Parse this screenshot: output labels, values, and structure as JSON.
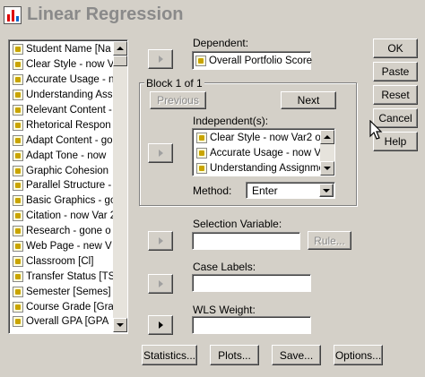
{
  "window": {
    "title": "Linear Regression"
  },
  "variables": {
    "items": [
      "Student Name [Na",
      "Clear Style - now V",
      "Accurate Usage - n",
      "Understanding Assig",
      "Relevant Content -",
      "Rhetorical Respon",
      "Adapt Content - go",
      "Adapt Tone - now",
      "Graphic Cohesion",
      "Parallel Structure -",
      "Basic Graphics - go",
      "Citation - now Var 2",
      "Research - gone o",
      "Web Page - new V",
      "Classroom [Cl]",
      "Transfer Status [TS",
      "Semester [Semes]",
      "Course Grade [Gra",
      "Overall GPA [GPA"
    ]
  },
  "dependent": {
    "label": "Dependent:",
    "value": "Overall Portfolio Score"
  },
  "block": {
    "label": "Block 1 of 1",
    "previous_label": "Previous",
    "next_label": "Next"
  },
  "independents": {
    "label": "Independent(s):",
    "items": [
      "Clear Style - now Var2 o",
      "Accurate Usage - now V",
      "Understanding Assignme"
    ]
  },
  "method": {
    "label": "Method:",
    "value": "Enter"
  },
  "selection": {
    "label": "Selection Variable:",
    "value": "",
    "rule_label": "Rule..."
  },
  "case_labels": {
    "label": "Case Labels:",
    "value": ""
  },
  "wls": {
    "label": "WLS Weight:",
    "value": ""
  },
  "side_buttons": {
    "ok": "OK",
    "paste": "Paste",
    "reset": "Reset",
    "cancel": "Cancel",
    "help": "Help"
  },
  "bottom_buttons": {
    "statistics": "Statistics...",
    "plots": "Plots...",
    "save": "Save...",
    "options": "Options..."
  }
}
